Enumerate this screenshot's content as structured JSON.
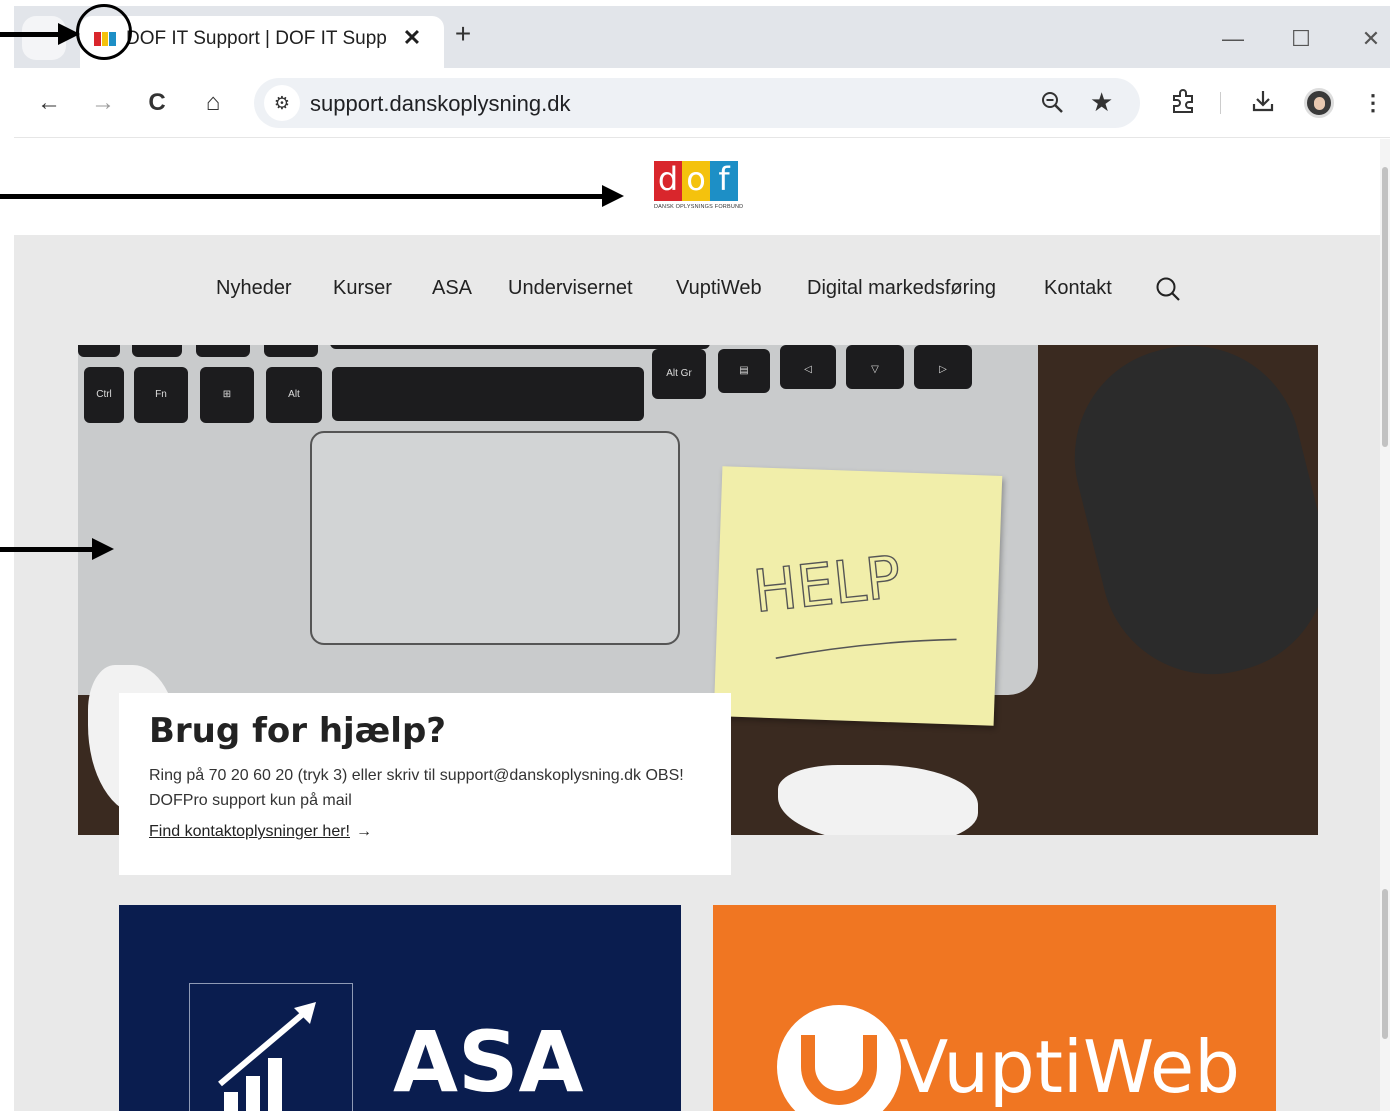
{
  "browser": {
    "tab_title": "DOF IT Support | DOF IT Support",
    "new_tab_label": "+",
    "close_tab_label": "✕",
    "url": "support.danskoplysning.dk",
    "window_controls": {
      "minimize": "—",
      "maximize": "☐",
      "close": "✕"
    },
    "nav": {
      "back": "←",
      "forward": "→",
      "reload": "C",
      "home": "⌂"
    },
    "icons": [
      "tab-search-icon",
      "site-info-icon",
      "zoom-icon",
      "star-icon",
      "extensions-icon",
      "download-icon",
      "profile-avatar",
      "kebab-menu-icon"
    ],
    "favicon_colors": [
      "#d9262c",
      "#f4c20d",
      "#1d8fc6"
    ]
  },
  "site": {
    "logo": {
      "letters": [
        "d",
        "o",
        "f"
      ],
      "letter_colors": [
        "#d9262c",
        "#f4c20d",
        "#1d8fc6"
      ],
      "subtitle": "DANSK OPLYSNINGS FORBUND"
    },
    "nav_items": [
      "Nyheder",
      "Kurser",
      "ASA",
      "Undervisernet",
      "VuptiWeb",
      "Digital markedsføring",
      "Kontakt"
    ],
    "hero": {
      "image_keys": [
        "Ctrl",
        "Fn",
        "Alt",
        "Alt Gr"
      ],
      "sticky_note_text": "HELP",
      "card_title": "Brug for hjælp?",
      "card_text": "Ring på 70 20 60 20 (tryk 3) eller skriv til support@danskoplysning.dk OBS! DOFPro support kun på mail",
      "card_link": "Find kontaktoplysninger her!",
      "card_link_arrow": "→"
    },
    "tiles": [
      {
        "label": "ASA",
        "color": "#0a1d4f"
      },
      {
        "label": "VuptiWeb",
        "color": "#f07622"
      }
    ]
  }
}
